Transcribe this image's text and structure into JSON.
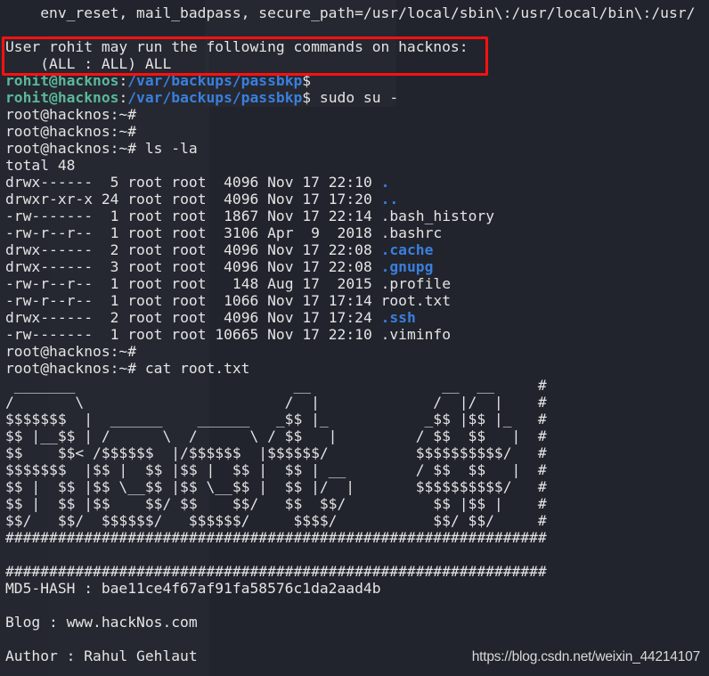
{
  "terminal": {
    "sudo_defaults": "    env_reset, mail_badpass, secure_path=/usr/local/sbin\\:/usr/local/bin\\:/usr/",
    "sudo_rights_header": "User rohit may run the following commands on hacknos:",
    "sudo_rights_entry": "    (ALL : ALL) ALL",
    "user_prompt": {
      "user_host": "rohit@hacknos",
      "sep": ":",
      "path": "/var/backups/passbkp",
      "symbol": "$"
    },
    "sudo_command": " sudo su -",
    "root_prompt": "root@hacknos:~#",
    "ls_command": " ls -la",
    "cat_command": " cat root.txt",
    "listing_total": "total 48",
    "listing": [
      {
        "perms": "drwx------",
        "links": "5",
        "owner": "root",
        "group": "root",
        "size": "4096",
        "date": "Nov 17 22:10",
        "name": ".",
        "is_dir": true
      },
      {
        "perms": "drwxr-xr-x",
        "links": "24",
        "owner": "root",
        "group": "root",
        "size": "4096",
        "date": "Nov 17 17:20",
        "name": "..",
        "is_dir": true
      },
      {
        "perms": "-rw-------",
        "links": "1",
        "owner": "root",
        "group": "root",
        "size": "1867",
        "date": "Nov 17 22:14",
        "name": ".bash_history",
        "is_dir": false
      },
      {
        "perms": "-rw-r--r--",
        "links": "1",
        "owner": "root",
        "group": "root",
        "size": "3106",
        "date": "Apr  9  2018",
        "name": ".bashrc",
        "is_dir": false
      },
      {
        "perms": "drwx------",
        "links": "2",
        "owner": "root",
        "group": "root",
        "size": "4096",
        "date": "Nov 17 22:08",
        "name": ".cache",
        "is_dir": true
      },
      {
        "perms": "drwx------",
        "links": "3",
        "owner": "root",
        "group": "root",
        "size": "4096",
        "date": "Nov 17 22:08",
        "name": ".gnupg",
        "is_dir": true
      },
      {
        "perms": "-rw-r--r--",
        "links": "1",
        "owner": "root",
        "group": "root",
        "size": "148",
        "date": "Aug 17  2015",
        "name": ".profile",
        "is_dir": false
      },
      {
        "perms": "-rw-r--r--",
        "links": "1",
        "owner": "root",
        "group": "root",
        "size": "1066",
        "date": "Nov 17 17:14",
        "name": "root.txt",
        "is_dir": false
      },
      {
        "perms": "drwx------",
        "links": "2",
        "owner": "root",
        "group": "root",
        "size": "4096",
        "date": "Nov 17 17:24",
        "name": ".ssh",
        "is_dir": true
      },
      {
        "perms": "-rw-------",
        "links": "1",
        "owner": "root",
        "group": "root",
        "size": "10665",
        "date": "Nov 17 22:10",
        "name": ".viminfo",
        "is_dir": false
      }
    ],
    "banner": [
      " _______                         __               __  __     #",
      "/       \\                       /  |             /  |/  |    #",
      "$$$$$$$  |  ______    ______   _$$ |_           _$$ |$$ |_   #",
      "$$ |__$$ | /      \\  /      \\ / $$   |         / $$  $$   |  #",
      "$$    $$< /$$$$$$  |/$$$$$$  |$$$$$$/          $$$$$$$$$$/   #",
      "$$$$$$$  |$$ |  $$ |$$ |  $$ |  $$ | __        / $$  $$   |  #",
      "$$ |  $$ |$$ \\__$$ |$$ \\__$$ |  $$ |/  |       $$$$$$$$$$/   #",
      "$$ |  $$ |$$    $$/ $$    $$/   $$  $$/          $$ |$$ |    #",
      "$$/   $$/  $$$$$$/   $$$$$$/     $$$$/           $$/ $$/     #",
      "##############################################################"
    ],
    "hash_separator": "##############################################################",
    "md5_line": "MD5-HASH : bae11ce4f67af91fa58576c1da2aad4b",
    "blog_line": "Blog : www.hackNos.com",
    "author_line": "Author : Rahul Gehlaut"
  },
  "watermark": "https://blog.csdn.net/weixin_44214107",
  "colors": {
    "background": "#21242d",
    "prompt_green": "#5ab89a",
    "path_blue": "#3a7fdc",
    "directory_blue": "#3a7fdc",
    "highlight_box": "#ff1010"
  }
}
